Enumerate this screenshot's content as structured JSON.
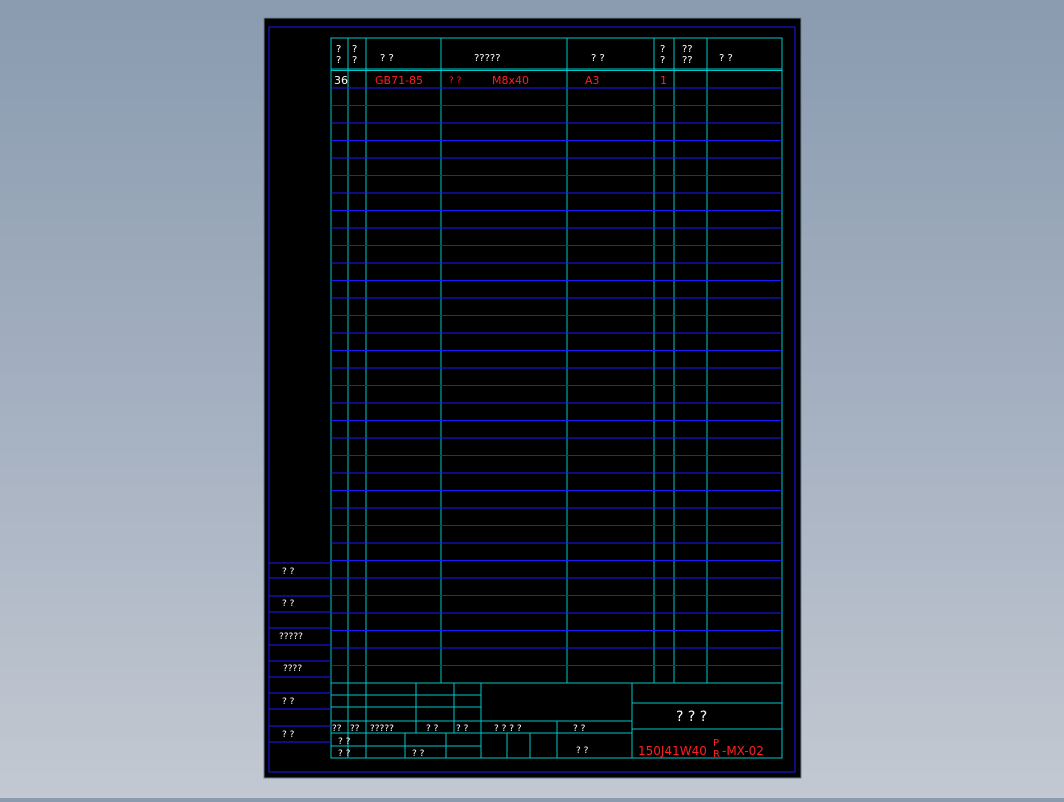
{
  "header": {
    "col_seq": "?\n?",
    "col_code": "?\n?",
    "col_std": "?   ?",
    "col_name": "?????",
    "col_material": "?   ?",
    "col_qty": "?\n?",
    "col_weight": "??\n??",
    "col_remark": "?     ?"
  },
  "rows": [
    {
      "seq": "36",
      "std": "GB71-85",
      "name_prefix": "?   ?",
      "name": "M8x40",
      "material": "A3",
      "qty": "1"
    }
  ],
  "side_labels": [
    "?   ?",
    "?   ?",
    "?????",
    "????",
    "?   ?",
    "?   ?"
  ],
  "title_block": {
    "sig_row1": [
      "??",
      "??",
      "?????",
      "?  ?",
      "?  ?"
    ],
    "sig_row2": [
      "?  ?",
      "?  ?"
    ],
    "sig_row3_extra": "?  ?",
    "scale_labels": [
      "?   ?   ?   ?"
    ],
    "sheet_label_1": "?      ?",
    "sheet_label_2": "?      ?",
    "drawing_title": "?   ?   ?",
    "drawing_number_main": "150J41W40",
    "drawing_number_sup": "P",
    "drawing_number_sub": "R",
    "drawing_number_suffix": "-MX-02"
  }
}
